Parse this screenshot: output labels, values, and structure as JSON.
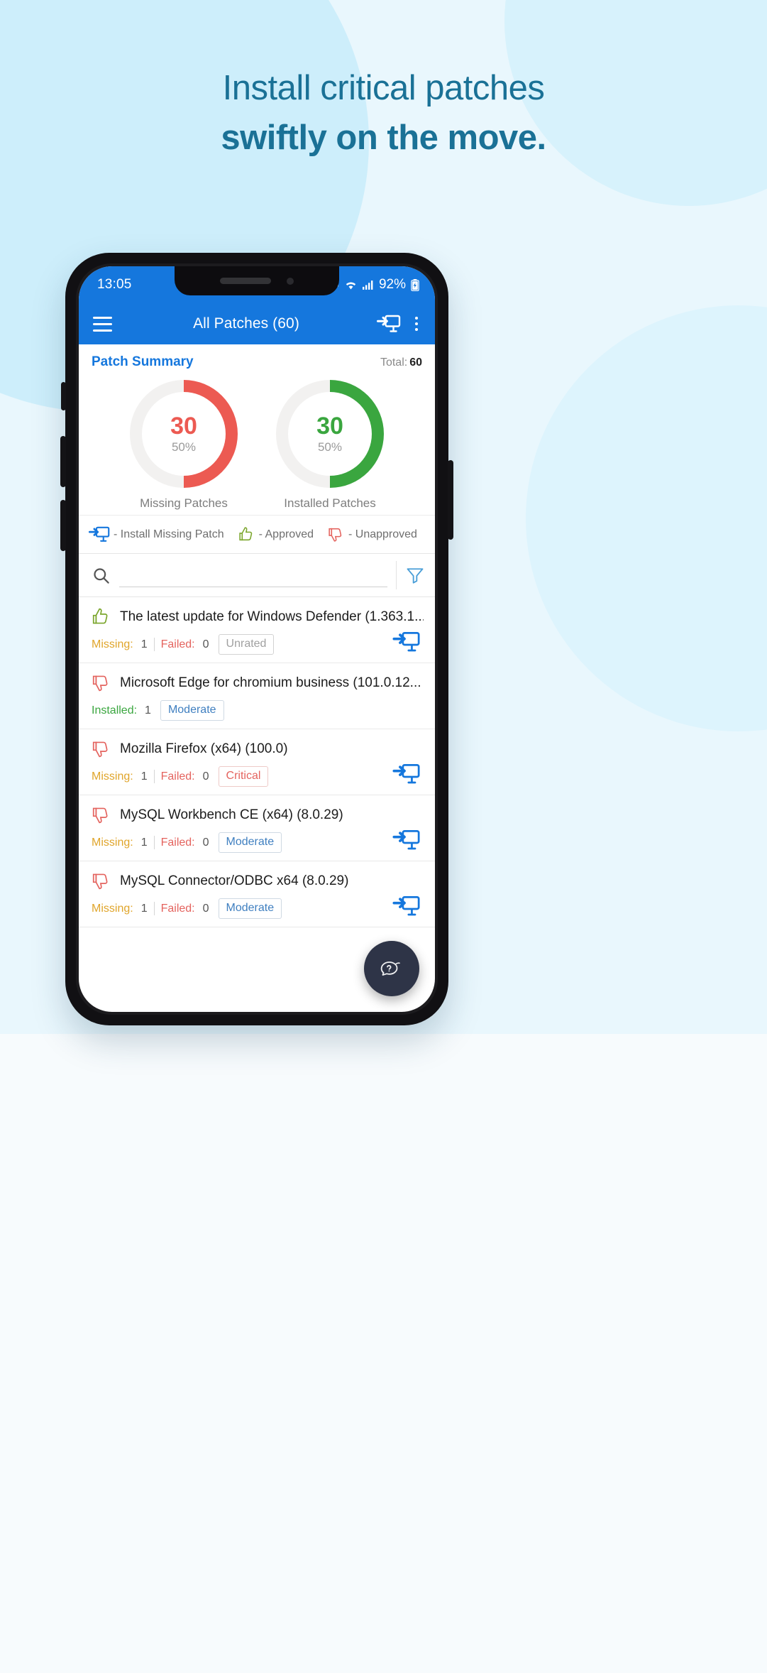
{
  "promo": {
    "line1": "Install critical patches",
    "line2": "swiftly on the move.",
    "accent_color": "#1a7196",
    "background_color": "#e9f7fd"
  },
  "status_bar": {
    "time": "13:05",
    "battery_percent": "92%",
    "icons": [
      "vibrate-icon",
      "wifi-icon",
      "signal-icon",
      "battery-charging-icon"
    ]
  },
  "app_bar": {
    "menu_icon": "hamburger-menu-icon",
    "title": "All Patches (60)",
    "install_icon": "install-patch-icon",
    "overflow_icon": "kebab-menu-icon",
    "background_color": "#1577dd"
  },
  "summary": {
    "title": "Patch Summary",
    "total_label": "Total:",
    "total_value": "60"
  },
  "chart_data": {
    "type": "pie",
    "title": "Patch Summary",
    "legend_position": "below",
    "total": 60,
    "categories": [
      "Missing Patches",
      "Installed Patches"
    ],
    "values": [
      30,
      30
    ],
    "percent_labels": [
      "50%",
      "50%"
    ],
    "colors": [
      "#ec5a52",
      "#3aa63f"
    ],
    "track_color": "#f2f1f0",
    "series": [
      {
        "name": "Missing Patches",
        "value": 30,
        "percent": "50%",
        "color": "#ec5a52"
      },
      {
        "name": "Installed Patches",
        "value": 30,
        "percent": "50%",
        "color": "#3aa63f"
      }
    ]
  },
  "donuts": [
    {
      "value": "30",
      "percent": "50%",
      "label": "Missing Patches",
      "color": "#ec5a52"
    },
    {
      "value": "30",
      "percent": "50%",
      "label": "Installed Patches",
      "color": "#3aa63f"
    }
  ],
  "legend": [
    {
      "icon": "install-patch-icon",
      "text": "- Install Missing Patch"
    },
    {
      "icon": "thumbs-up-icon",
      "text": "- Approved"
    },
    {
      "icon": "thumbs-down-icon",
      "text": "- Unapproved"
    }
  ],
  "search": {
    "icon": "search-icon",
    "value": "",
    "placeholder": "",
    "filter_icon": "filter-funnel-icon"
  },
  "patches": [
    {
      "approval_icon": "thumbs-up-icon",
      "name": "The latest update for Windows Defender (1.363.1...",
      "status_label": "Missing:",
      "status_type": "missing",
      "status_count": "1",
      "failed_label": "Failed:",
      "failed_count": "0",
      "severity": "Unrated",
      "severity_type": "unrated",
      "has_install": true
    },
    {
      "approval_icon": "thumbs-down-icon",
      "name": "Microsoft Edge for chromium business (101.0.12...",
      "status_label": "Installed:",
      "status_type": "installed",
      "status_count": "1",
      "failed_label": "",
      "failed_count": "",
      "severity": "Moderate",
      "severity_type": "moderate",
      "has_install": false
    },
    {
      "approval_icon": "thumbs-down-icon",
      "name": "Mozilla Firefox (x64) (100.0)",
      "status_label": "Missing:",
      "status_type": "missing",
      "status_count": "1",
      "failed_label": "Failed:",
      "failed_count": "0",
      "severity": "Critical",
      "severity_type": "critical",
      "has_install": true
    },
    {
      "approval_icon": "thumbs-down-icon",
      "name": "MySQL Workbench CE (x64) (8.0.29)",
      "status_label": "Missing:",
      "status_type": "missing",
      "status_count": "1",
      "failed_label": "Failed:",
      "failed_count": "0",
      "severity": "Moderate",
      "severity_type": "moderate",
      "has_install": true
    },
    {
      "approval_icon": "thumbs-down-icon",
      "name": "MySQL Connector/ODBC x64 (8.0.29)",
      "status_label": "Missing:",
      "status_type": "missing",
      "status_count": "1",
      "failed_label": "Failed:",
      "failed_count": "0",
      "severity": "Moderate",
      "severity_type": "moderate",
      "has_install": true
    }
  ],
  "fab": {
    "icon": "chat-assistant-icon",
    "color": "#2e3447"
  }
}
